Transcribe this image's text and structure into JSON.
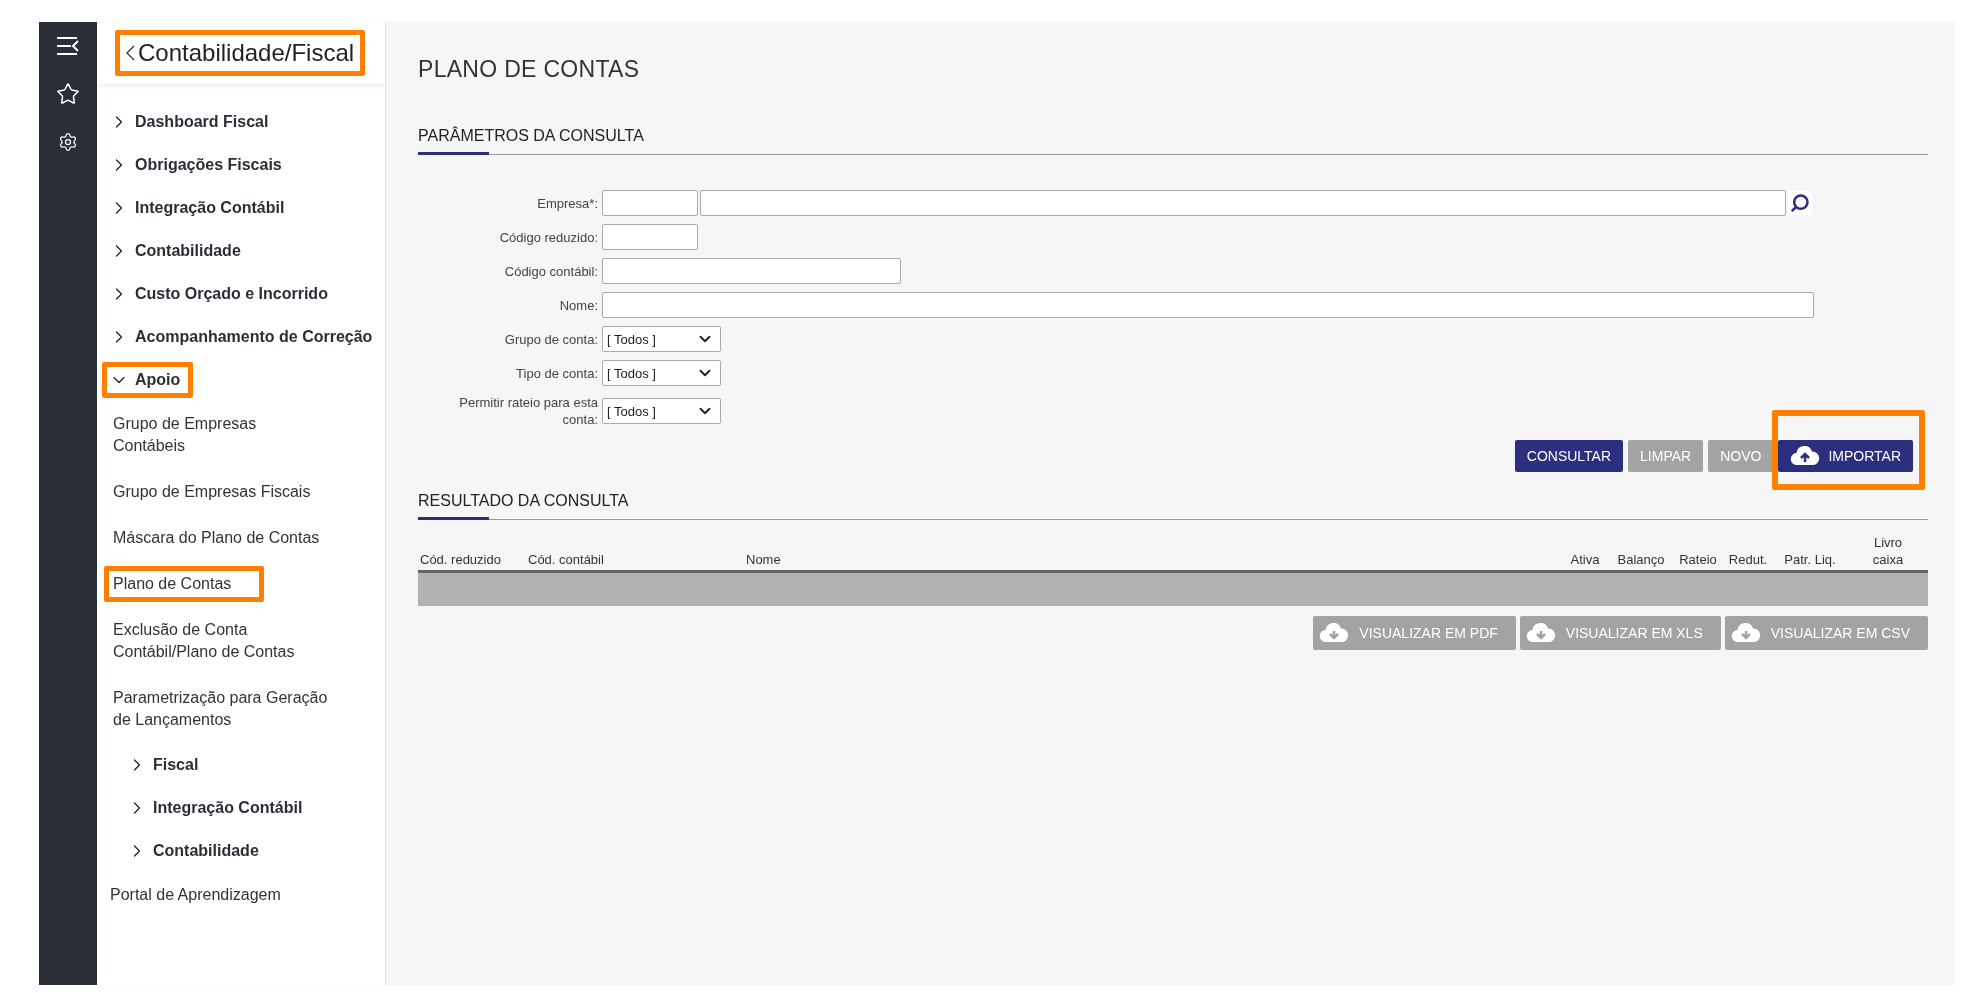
{
  "sidebar": {
    "title": "Contabilidade/Fiscal",
    "title_highlighted": true,
    "items": [
      {
        "kind": "group",
        "label": "Dashboard Fiscal",
        "expanded": false,
        "highlighted": false
      },
      {
        "kind": "group",
        "label": "Obrigações Fiscais",
        "expanded": false,
        "highlighted": false
      },
      {
        "kind": "group",
        "label": "Integração Contábil",
        "expanded": false,
        "highlighted": false
      },
      {
        "kind": "group",
        "label": "Contabilidade",
        "expanded": false,
        "highlighted": false
      },
      {
        "kind": "group",
        "label": "Custo Orçado e Incorrido",
        "expanded": false,
        "highlighted": false
      },
      {
        "kind": "group",
        "label": "Acompanhamento de Correção",
        "expanded": false,
        "highlighted": false
      },
      {
        "kind": "group",
        "label": "Apoio",
        "expanded": true,
        "highlighted": true,
        "children": [
          {
            "kind": "link",
            "label": "Grupo de Empresas Contábeis",
            "highlighted": false
          },
          {
            "kind": "link",
            "label": "Grupo de Empresas Fiscais",
            "highlighted": false
          },
          {
            "kind": "link",
            "label": "Máscara do Plano de Contas",
            "highlighted": false
          },
          {
            "kind": "link",
            "label": "Plano de Contas",
            "highlighted": true
          },
          {
            "kind": "link",
            "label": "Exclusão de Conta Contábil/Plano de Contas",
            "highlighted": false
          },
          {
            "kind": "link",
            "label": "Parametrização para Geração de Lançamentos",
            "highlighted": false
          },
          {
            "kind": "group",
            "label": "Fiscal",
            "expanded": false,
            "highlighted": false
          },
          {
            "kind": "group",
            "label": "Integração Contábil",
            "expanded": false,
            "highlighted": false
          },
          {
            "kind": "group",
            "label": "Contabilidade",
            "expanded": false,
            "highlighted": false
          }
        ]
      },
      {
        "kind": "link",
        "label": "Portal de Aprendizagem",
        "highlighted": false
      }
    ]
  },
  "page": {
    "title": "PLANO DE CONTAS",
    "query": {
      "heading": "PARÂMETROS DA CONSULTA",
      "fields": [
        {
          "kind": "lookup",
          "label": "Empresa*:"
        },
        {
          "kind": "short",
          "label": "Código reduzido:"
        },
        {
          "kind": "medium",
          "label": "Código contábil:"
        },
        {
          "kind": "wide",
          "label": "Nome:"
        },
        {
          "kind": "select",
          "label": "Grupo de conta:",
          "value": "[ Todos ]"
        },
        {
          "kind": "select",
          "label": "Tipo de conta:",
          "value": "[ Todos ]"
        },
        {
          "kind": "select",
          "label": "Permitir rateio para esta conta:",
          "value": "[ Todos ]"
        }
      ],
      "buttons": [
        {
          "kind": "primary",
          "label": "CONSULTAR",
          "highlighted": false
        },
        {
          "kind": "secondary",
          "label": "LIMPAR",
          "highlighted": false
        },
        {
          "kind": "secondary",
          "label": "NOVO",
          "highlighted": false
        },
        {
          "kind": "upload",
          "label": "IMPORTAR",
          "highlighted": true
        }
      ]
    },
    "results": {
      "heading": "RESULTADO DA CONSULTA",
      "columns": [
        "Cód. reduzido",
        "Cód. contábil",
        "Nome",
        "Ativa",
        "Balanço",
        "Rateio",
        "Redut.",
        "Patr. Liq.",
        "Livro caixa"
      ],
      "exports": [
        "VISUALIZAR EM PDF",
        "VISUALIZAR EM XLS",
        "VISUALIZAR EM CSV"
      ]
    }
  }
}
